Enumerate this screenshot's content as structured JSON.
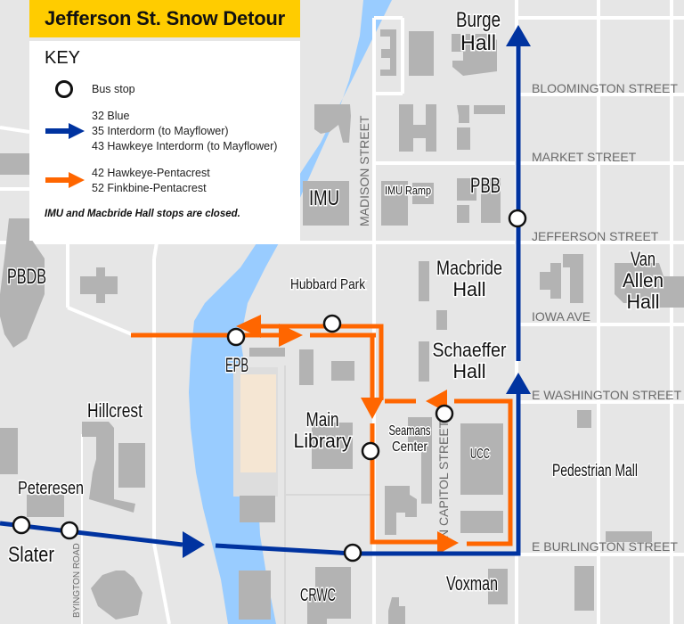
{
  "title": "Jefferson St. Snow Detour",
  "key": {
    "heading": "KEY",
    "items": [
      {
        "symbol": "bus-stop-circle",
        "lines": [
          "Bus stop"
        ]
      },
      {
        "symbol": "blue-arrow",
        "color": "#0033a0",
        "lines": [
          "32 Blue",
          "35 Interdorm (to Mayflower)",
          "43 Hawkeye Interdorm (to Mayflower)"
        ]
      },
      {
        "symbol": "orange-arrow",
        "color": "#ff6600",
        "lines": [
          "42 Hawkeye-Pentacrest",
          "52 Finkbine-Pentacrest"
        ]
      }
    ],
    "note": "IMU and Macbride Hall stops are closed."
  },
  "colors": {
    "title_bg": "#ffcc00",
    "blue_route": "#0033a0",
    "orange_route": "#ff6600",
    "river": "#99ccff",
    "land": "#e6e6e6",
    "building": "#b3b3b3",
    "field": "#f5e6d3",
    "street": "#ffffff"
  },
  "streets": [
    {
      "name": "BLOOMINGTON STREET"
    },
    {
      "name": "MARKET STREET"
    },
    {
      "name": "JEFFERSON STREET"
    },
    {
      "name": "IOWA AVE"
    },
    {
      "name": "E WASHINGTON STREET"
    },
    {
      "name": "E BURLINGTON STREET"
    },
    {
      "name": "MADISON STREET"
    },
    {
      "name": "N CAPITOL STREET"
    },
    {
      "name": "BYINGTON ROAD"
    }
  ],
  "buildings": [
    {
      "name": "Burge Hall"
    },
    {
      "name": "IMU"
    },
    {
      "name": "IMU Ramp"
    },
    {
      "name": "PBB"
    },
    {
      "name": "PBDB"
    },
    {
      "name": "Hubbard Park"
    },
    {
      "name": "Macbride Hall"
    },
    {
      "name": "Van Allen Hall"
    },
    {
      "name": "Schaeffer Hall"
    },
    {
      "name": "EPB"
    },
    {
      "name": "Hillcrest"
    },
    {
      "name": "Main Library"
    },
    {
      "name": "Seamans Center"
    },
    {
      "name": "UCC"
    },
    {
      "name": "Pedestrian Mall"
    },
    {
      "name": "Peteresen"
    },
    {
      "name": "Slater"
    },
    {
      "name": "CRWC"
    },
    {
      "name": "Voxman"
    }
  ]
}
